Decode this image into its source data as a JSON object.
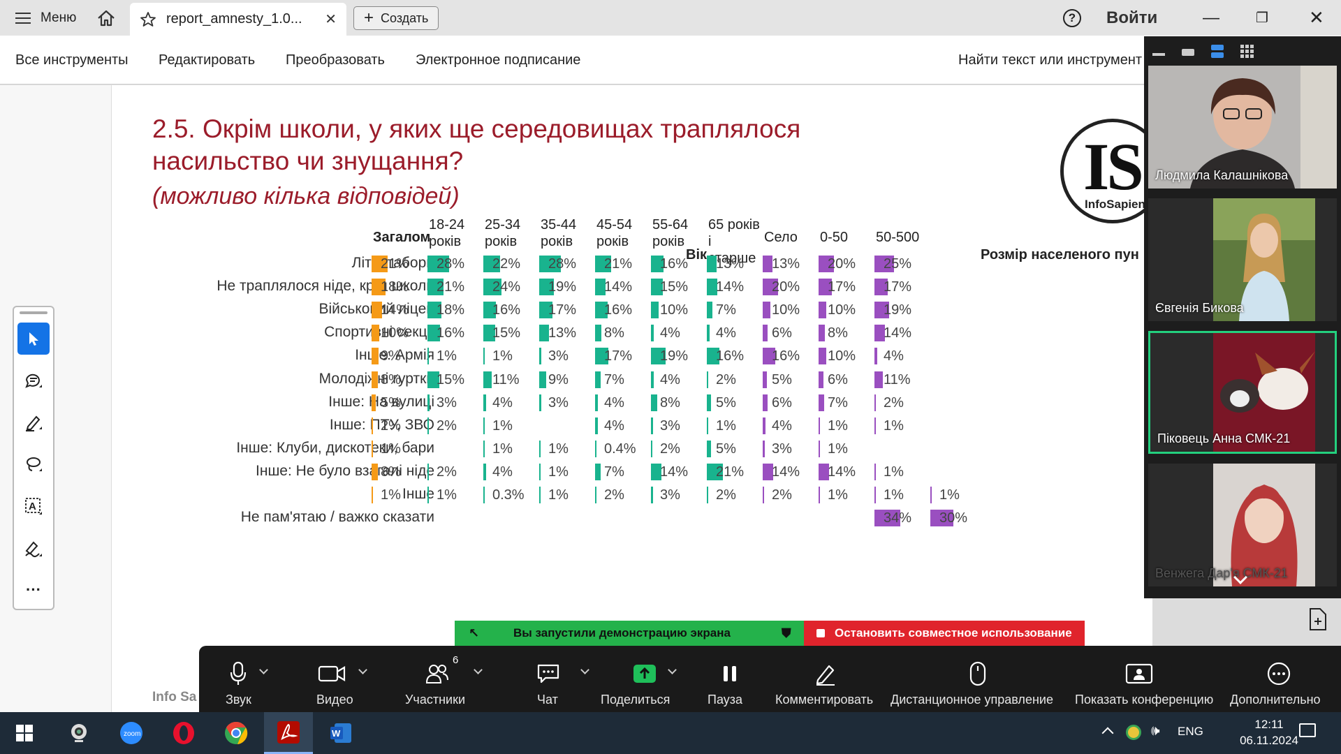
{
  "titlebar": {
    "menu_label": "Меню",
    "tab_title": "report_amnesty_1.0...",
    "create_label": "Создать",
    "login_label": "Войти"
  },
  "toolbar": {
    "tabs": [
      "Все инструменты",
      "Редактировать",
      "Преобразовать",
      "Электронное подписание"
    ],
    "find_label": "Найти текст или инструмент"
  },
  "slide": {
    "title": "2.5. Окрім школи, у яких ще середовищах траплялося насильство чи знущання?",
    "subtitle": "(можливо кілька відповідей)",
    "logo_big": "IS",
    "logo_small": "InfoSapiens",
    "footer": "Info Sa",
    "group_age": "Вік",
    "group_settlement": "Розмір населеного пун",
    "columns": [
      "Загалом",
      "18-24 років",
      "25-34 років",
      "35-44 років",
      "45-54 років",
      "55-64 років",
      "65 років і старше",
      "Село",
      "0-50",
      "50-500",
      ""
    ],
    "rows": [
      {
        "label": "Літні табори",
        "values": [
          "21%",
          "28%",
          "22%",
          "28%",
          "21%",
          "16%",
          "13%",
          "13%",
          "20%",
          "25%",
          ""
        ]
      },
      {
        "label": "Не траплялося ніде, крім школи",
        "values": [
          "18%",
          "21%",
          "24%",
          "19%",
          "14%",
          "15%",
          "14%",
          "20%",
          "17%",
          "17%",
          ""
        ]
      },
      {
        "label": "Військовий ліцей",
        "values": [
          "14%",
          "18%",
          "16%",
          "17%",
          "16%",
          "10%",
          "7%",
          "10%",
          "10%",
          "19%",
          ""
        ]
      },
      {
        "label": "Спортивні секції",
        "values": [
          "10%",
          "16%",
          "15%",
          "13%",
          "8%",
          "4%",
          "4%",
          "6%",
          "8%",
          "14%",
          ""
        ]
      },
      {
        "label": "Інше: Армія",
        "values": [
          "9%",
          "1%",
          "1%",
          "3%",
          "17%",
          "19%",
          "16%",
          "16%",
          "10%",
          "4%",
          ""
        ]
      },
      {
        "label": "Молодіжні гуртки",
        "values": [
          "8%",
          "15%",
          "11%",
          "9%",
          "7%",
          "4%",
          "2%",
          "5%",
          "6%",
          "11%",
          ""
        ]
      },
      {
        "label": "Інше: На вулиці",
        "values": [
          "5%",
          "3%",
          "4%",
          "3%",
          "4%",
          "8%",
          "5%",
          "6%",
          "7%",
          "2%",
          ""
        ]
      },
      {
        "label": "Інше: ПТУ, ЗВО",
        "values": [
          "2%",
          "2%",
          "1%",
          "",
          "4%",
          "3%",
          "1%",
          "4%",
          "1%",
          "1%",
          ""
        ]
      },
      {
        "label": "Інше: Клуби, дискотеки, бари",
        "values": [
          "1%",
          "",
          "1%",
          "1%",
          "0.4%",
          "2%",
          "5%",
          "3%",
          "1%",
          "",
          ""
        ]
      },
      {
        "label": "Інше: Не було взагалі ніде",
        "values": [
          "8%",
          "2%",
          "4%",
          "1%",
          "7%",
          "14%",
          "21%",
          "14%",
          "14%",
          "1%",
          ""
        ]
      },
      {
        "label": "Інше",
        "values": [
          "1%",
          "1%",
          "0.3%",
          "1%",
          "2%",
          "3%",
          "2%",
          "2%",
          "1%",
          "1%",
          "1%"
        ]
      },
      {
        "label": "Не пам'ятаю / важко сказати",
        "values": [
          "",
          "",
          "",
          "",
          "",
          "",
          "",
          "",
          "",
          "34%",
          "30%"
        ]
      }
    ]
  },
  "zoom_gallery": {
    "participants": [
      {
        "name": "Людмила Калашнікова"
      },
      {
        "name": "Євгенія Бикова"
      },
      {
        "name": "Піковець Анна СМК-21"
      },
      {
        "name": "Венжега Дар'я СМК-21"
      }
    ]
  },
  "share_banner": {
    "green_text": "Вы запустили демонстрацию экрана",
    "red_text": "Остановить совместное использование"
  },
  "zoom_controls": {
    "items": [
      "Звук",
      "Видео",
      "Участники",
      "Чат",
      "Поделиться",
      "Пауза",
      "Комментировать",
      "Дистанционное управление",
      "Показать конференцию",
      "Дополнительно"
    ],
    "participants_count": "6"
  },
  "taskbar": {
    "lang": "ENG",
    "time": "12:11",
    "date": "06.11.2024"
  },
  "colors": {
    "total": "#f59a17",
    "age": "#19b38e",
    "settlement": "#9a4fc0",
    "title": "#9b1c2a"
  }
}
